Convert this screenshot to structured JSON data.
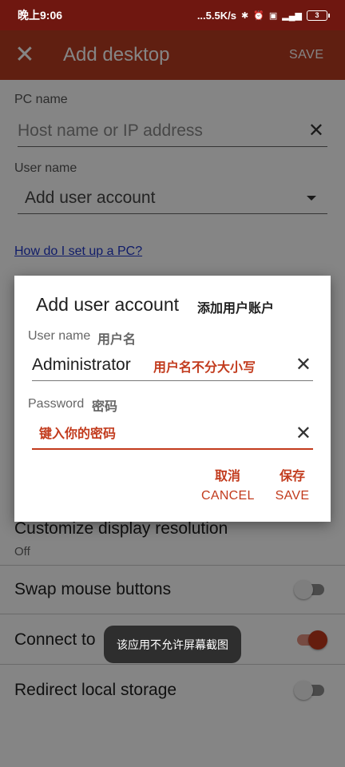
{
  "status_bar": {
    "time": "晚上9:06",
    "speed": "...5.5K/s",
    "battery": "3"
  },
  "app_bar": {
    "title": "Add desktop",
    "save_label": "SAVE"
  },
  "form": {
    "pc_name_label": "PC name",
    "pc_name_placeholder": "Host name or IP address",
    "user_name_label": "User name",
    "user_name_value": "Add user account",
    "help_link": "How do I set up a PC?",
    "display_resolution_title": "Customize display resolution",
    "display_resolution_value": "Off",
    "swap_mouse_label": "Swap mouse buttons",
    "swap_mouse_on": false,
    "connect_label": "Connect to",
    "connect_on": true,
    "redirect_storage_label": "Redirect local storage",
    "redirect_storage_on": false
  },
  "dialog": {
    "title": "Add user account",
    "title_annotation": "添加用户账户",
    "username_label": "User name",
    "username_label_annotation": "用户名",
    "username_value": "Administrator",
    "username_annotation": "用户名不分大小写",
    "password_label": "Password",
    "password_label_annotation": "密码",
    "password_annotation": "键入你的密码",
    "cancel_annotation": "取消",
    "cancel_label": "CANCEL",
    "save_annotation": "保存",
    "save_label": "SAVE"
  },
  "toast": {
    "text": "该应用不允许屏幕截图"
  },
  "colors": {
    "status_bar": "#6f1710",
    "app_bar": "#b93c22",
    "accent": "#c23b1d"
  }
}
